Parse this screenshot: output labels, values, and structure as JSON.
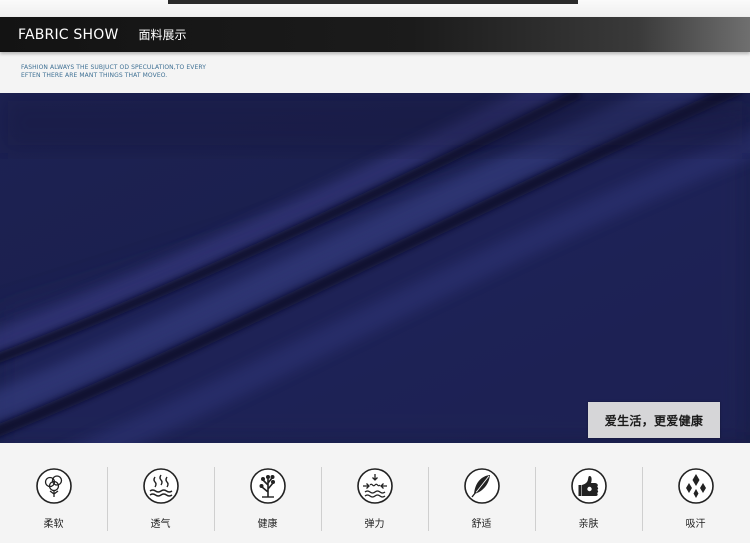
{
  "header": {
    "title": "FABRIC SHOW",
    "subtitle": "面料展示",
    "tagline_line1": "FASHION ALWAYS THE  SUBJUCT OD SPECULATION,TO EVERY",
    "tagline_line2": "EFTEN THERE ARE MANT THINGS THAT MOVEO."
  },
  "fabric": {
    "color": "#1c2150",
    "caption": "爱生活，更爱健康"
  },
  "features": [
    {
      "icon": "cotton-icon",
      "label": "柔软"
    },
    {
      "icon": "breathable-icon",
      "label": "透气"
    },
    {
      "icon": "tree-icon",
      "label": "健康"
    },
    {
      "icon": "stretch-icon",
      "label": "弹力"
    },
    {
      "icon": "feather-icon",
      "label": "舒适"
    },
    {
      "icon": "thumbs-up-icon",
      "label": "亲肤"
    },
    {
      "icon": "sweat-drops-icon",
      "label": "吸汗"
    }
  ]
}
